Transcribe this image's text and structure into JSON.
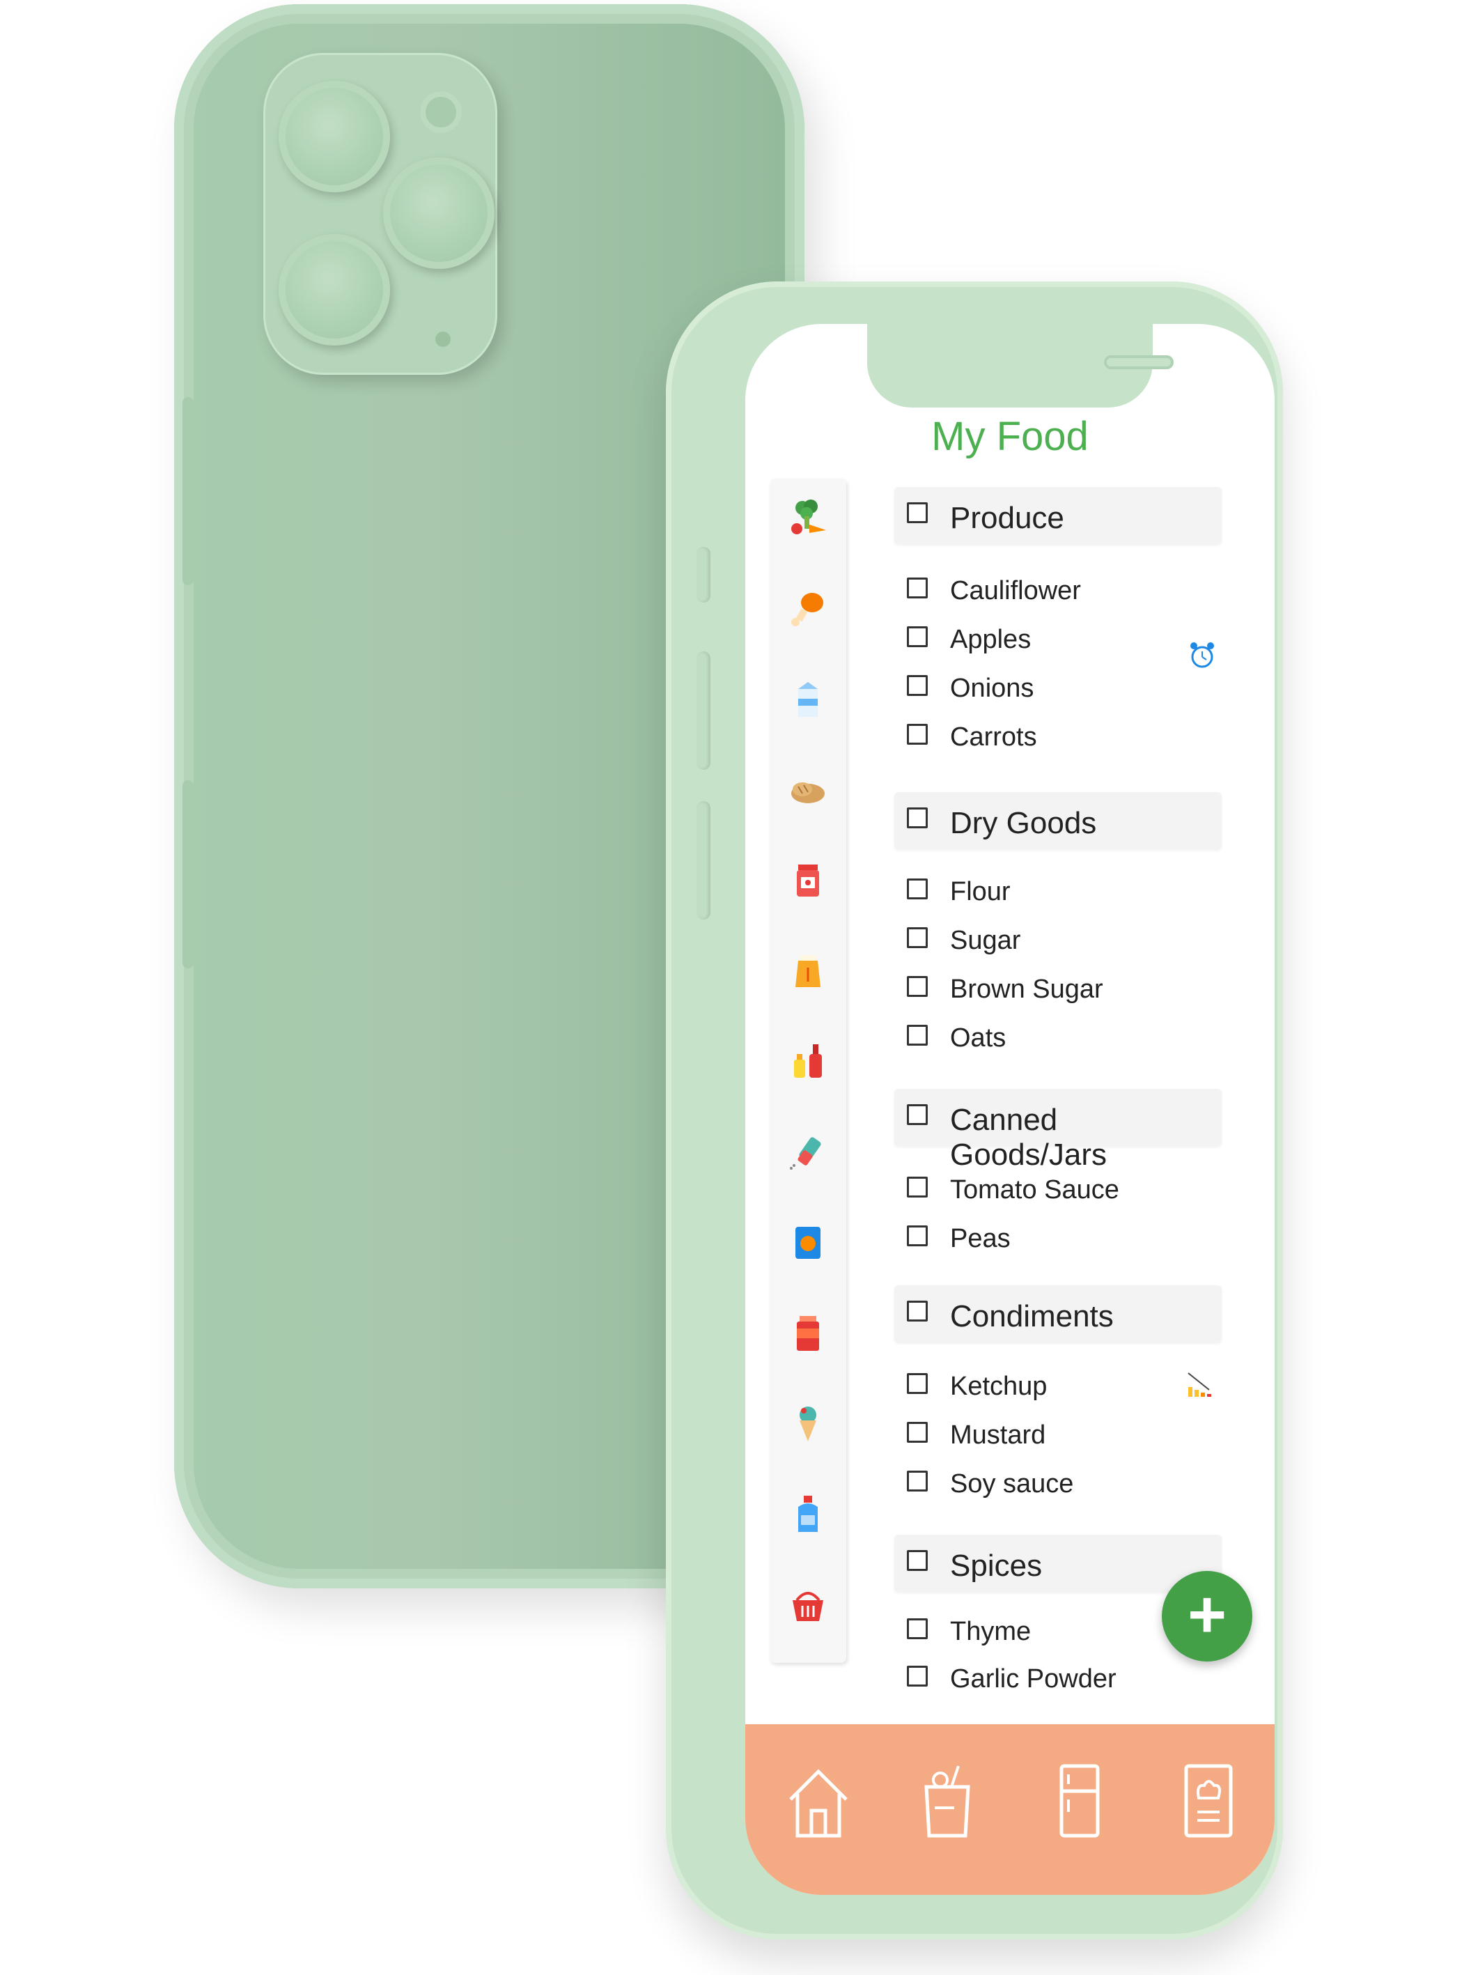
{
  "app": {
    "title": "My Food"
  },
  "sidebar": {
    "icons": [
      "broccoli-carrot-icon",
      "chicken-leg-icon",
      "milk-carton-icon",
      "bread-icon",
      "jam-jar-icon",
      "flour-sack-icon",
      "condiment-bottles-icon",
      "salt-shaker-icon",
      "chips-bag-icon",
      "canned-food-icon",
      "ice-cream-icon",
      "detergent-bottle-icon",
      "shopping-basket-icon"
    ]
  },
  "sections": [
    {
      "name": "Produce",
      "items": [
        "Cauliflower",
        "Apples",
        "Onions",
        "Carrots"
      ]
    },
    {
      "name": "Dry Goods",
      "items": [
        "Flour",
        "Sugar",
        "Brown Sugar",
        "Oats"
      ]
    },
    {
      "name": "Canned Goods/Jars",
      "items": [
        "Tomato Sauce",
        "Peas"
      ]
    },
    {
      "name": "Condiments",
      "items": [
        "Ketchup",
        "Mustard",
        "Soy sauce"
      ]
    },
    {
      "name": "Spices",
      "items": [
        "Thyme",
        "Garlic Powder"
      ]
    }
  ],
  "indicators": {
    "apples": "alarm-clock-icon",
    "ketchup": "low-stock-chart-icon"
  },
  "fab": {
    "label": "+"
  },
  "bottom_nav": [
    "home-icon",
    "grocery-bag-icon",
    "fridge-icon",
    "recipe-book-icon"
  ],
  "colors": {
    "accent": "#4caf50",
    "fab": "#43a047",
    "bottom_nav": "#f4ab83",
    "phone_body": "#a8cbad"
  }
}
